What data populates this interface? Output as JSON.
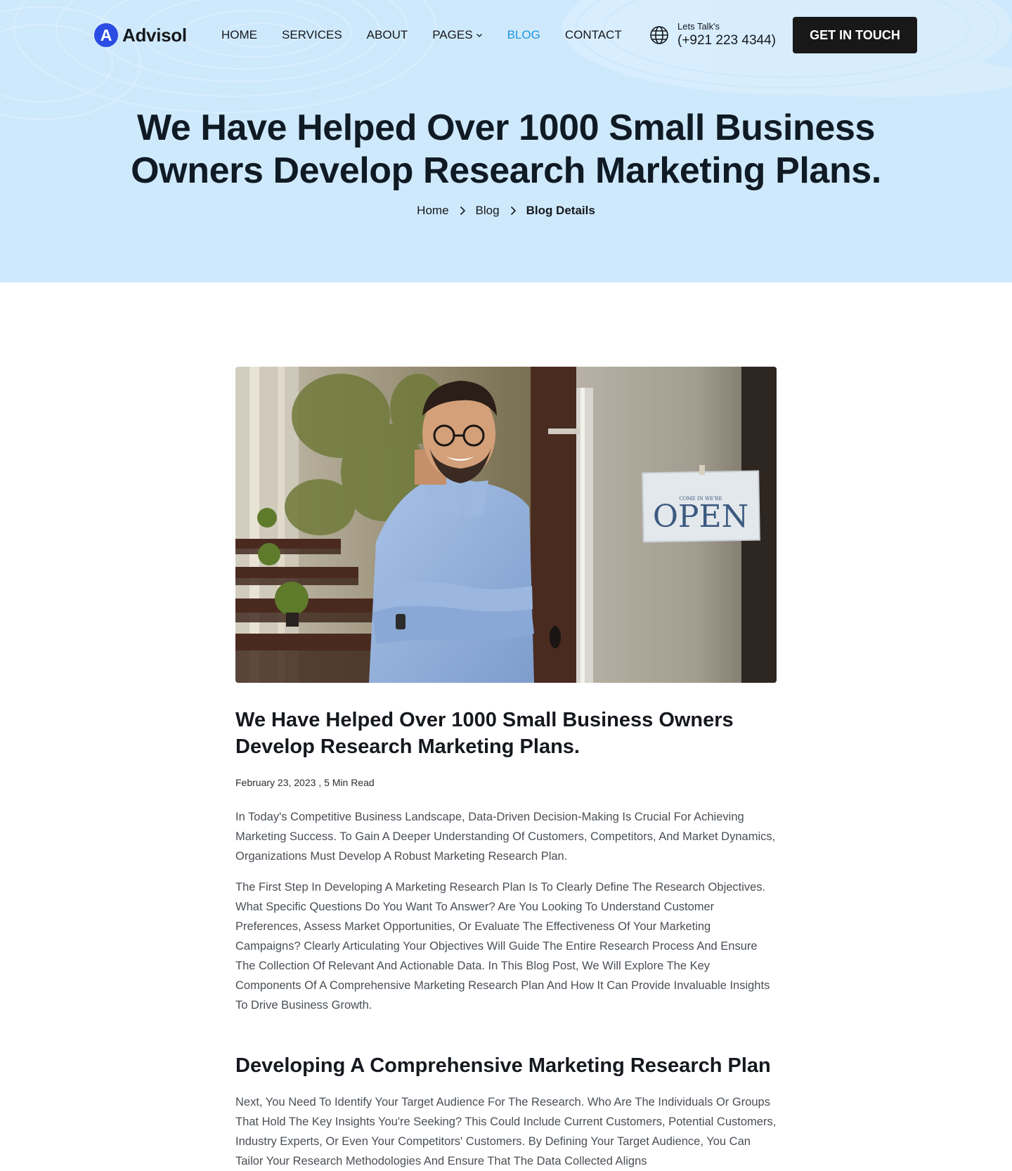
{
  "brand": {
    "logo_letter": "A",
    "name": "Advisol",
    "accent": "#2b4de3"
  },
  "nav": {
    "items": [
      {
        "label": "HOME",
        "active": false
      },
      {
        "label": "SERVICES",
        "active": false
      },
      {
        "label": "ABOUT",
        "active": false
      },
      {
        "label": "PAGES",
        "active": false,
        "has_dropdown": true
      },
      {
        "label": "BLOG",
        "active": true
      },
      {
        "label": "CONTACT",
        "active": false
      }
    ],
    "active_color": "#1e96e0"
  },
  "contact": {
    "label": "Lets Talk's",
    "phone": "(+921 223 4344)",
    "icon": "globe-icon"
  },
  "cta": {
    "label": "GET IN TOUCH"
  },
  "hero": {
    "title": "We Have Helped Over 1000 Small Business\nOwners Develop Research  Marketing Plans.",
    "background": "#cfe9fc"
  },
  "breadcrumb": [
    {
      "label": "Home"
    },
    {
      "label": "Blog"
    },
    {
      "label": "Blog Details"
    }
  ],
  "article": {
    "image_sign_small": "COME IN WE'RE",
    "image_sign_text": "OPEN",
    "title": "We Have Helped Over 1000 Small Business Owners\nDevelop Research  Marketing Plans.",
    "meta": "February 23, 2023 , 5 Min Read",
    "paragraphs": [
      "In Today's Competitive Business Landscape, Data-Driven Decision-Making Is Crucial For Achieving Marketing Success. To Gain A Deeper Understanding Of Customers, Competitors, And Market Dynamics, Organizations Must Develop A Robust Marketing Research Plan.",
      "The First Step In Developing A Marketing Research Plan Is To Clearly Define The Research Objectives. What Specific Questions Do You Want To Answer? Are You Looking To Understand Customer Preferences, Assess Market Opportunities, Or Evaluate The Effectiveness Of Your Marketing Campaigns? Clearly Articulating Your Objectives Will Guide The Entire Research Process And Ensure The Collection Of Relevant And Actionable Data. In This Blog Post, We Will Explore The Key Components Of A Comprehensive Marketing Research Plan And How It Can Provide Invaluable Insights To Drive Business Growth."
    ],
    "section_heading": "Developing A Comprehensive Marketing Research Plan",
    "section_paragraph": "Next, You Need To Identify Your Target Audience For The Research. Who Are The Individuals Or Groups That Hold The Key Insights You're Seeking? This Could Include Current Customers, Potential Customers, Industry Experts, Or Even Your Competitors' Customers. By Defining Your Target Audience, You Can Tailor Your Research Methodologies And Ensure That The Data Collected Aligns"
  }
}
